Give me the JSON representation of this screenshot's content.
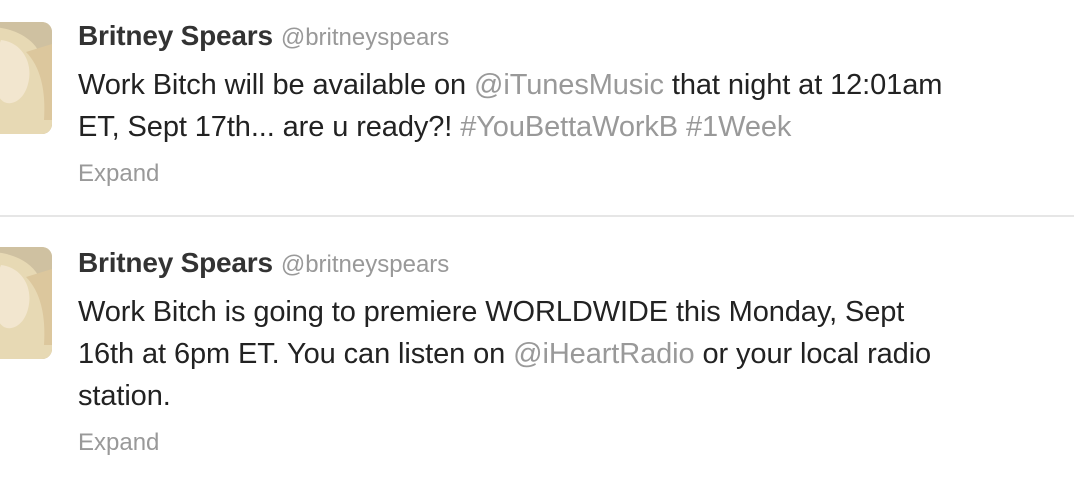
{
  "tweets": [
    {
      "fullname": "Britney Spears",
      "username": "@britneyspears",
      "line1": {
        "a": "Work Bitch will be available on ",
        "mention": "@iTunesMusic",
        "b": " that night at 12:01am"
      },
      "line2": {
        "a": "ET, Sept 17th... are u ready?! ",
        "hashtag1": "#YouBettaWorkB",
        "hashtag2": "#1Week"
      },
      "expand": "Expand"
    },
    {
      "fullname": "Britney Spears",
      "username": "@britneyspears",
      "line1": "Work Bitch is going to premiere WORLDWIDE this Monday, Sept",
      "line2": {
        "a": "16th at 6pm ET. You can listen on ",
        "mention": "@iHeartRadio",
        "b": " or your local radio"
      },
      "line3": "station.",
      "expand": "Expand"
    }
  ],
  "colors": {
    "text": "#222222",
    "name": "#333333",
    "muted_link": "#999999",
    "divider": "#e6e6e6"
  },
  "icons": {
    "avatar": "profile-photo"
  }
}
